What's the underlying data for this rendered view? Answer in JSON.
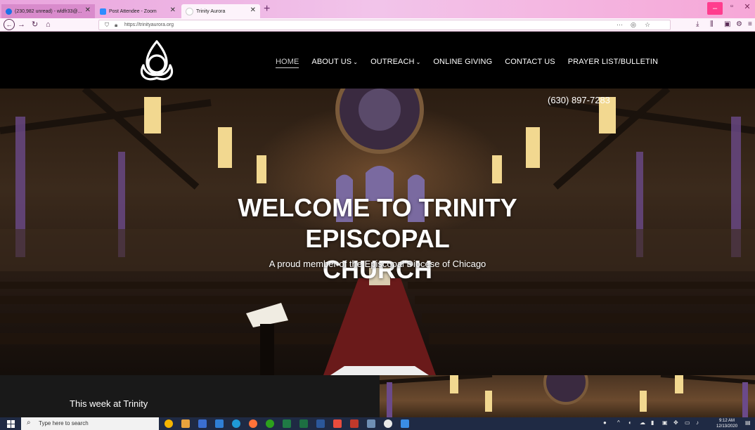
{
  "browser": {
    "tabs": [
      {
        "label": "(230,982 unread) - wldfr33@...",
        "favicon_color": "#1a73e8"
      },
      {
        "label": "Post Attendee - Zoom",
        "favicon_color": "#2d8cff"
      },
      {
        "label": "Trinity Aurora",
        "favicon_color": "#ffffff"
      }
    ],
    "url": "https://trinityaurora.org",
    "colors": {
      "chrome_gradient_start": "#e9a4dd",
      "chrome_gradient_end": "#f6a7d7"
    }
  },
  "site": {
    "nav": [
      {
        "label": "HOME",
        "has_dropdown": false
      },
      {
        "label": "ABOUT US",
        "has_dropdown": true
      },
      {
        "label": "OUTREACH",
        "has_dropdown": true
      },
      {
        "label": "ONLINE GIVING",
        "has_dropdown": false
      },
      {
        "label": "CONTACT US",
        "has_dropdown": false
      },
      {
        "label": "PRAYER LIST/BULLETIN",
        "has_dropdown": false
      }
    ],
    "phone": "(630) 897-7283",
    "hero": {
      "title_line1": "WELCOME TO TRINITY EPISCOPAL",
      "title_line2": "CHURCH",
      "subtitle": "A proud member of the Episcopal Diocese of Chicago"
    },
    "week_title": "This week at Trinity"
  },
  "taskbar": {
    "search_placeholder": "Type here to search",
    "time": "9:12 AM",
    "date": "12/13/2020"
  }
}
